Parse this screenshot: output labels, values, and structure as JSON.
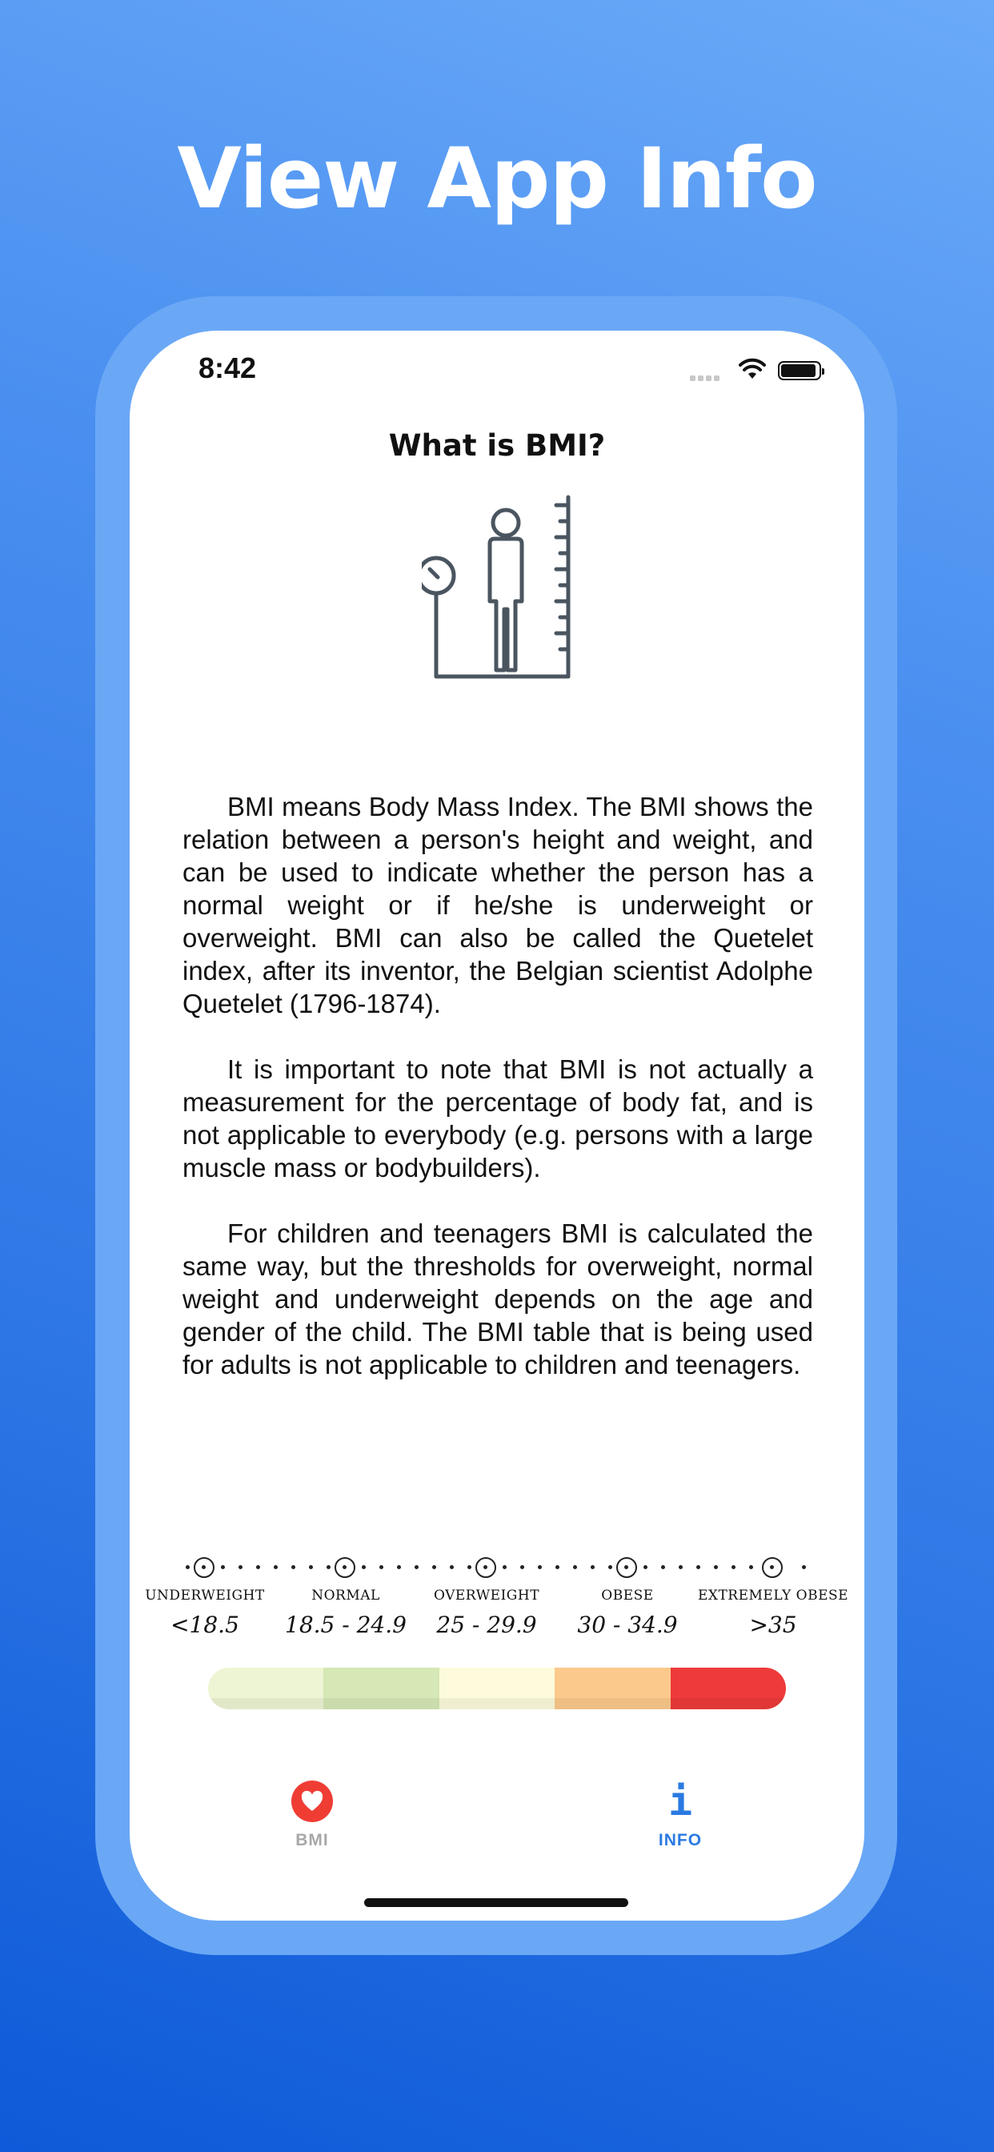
{
  "headline": "View App Info",
  "status_bar": {
    "time": "8:42"
  },
  "page": {
    "title": "What is BMI?"
  },
  "info": {
    "paragraphs": [
      "BMI means Body Mass Index. The BMI shows the relation between a person's height and weight, and can be used to indicate whether the person has a normal weight or if he/she is underweight or overweight. BMI can also be called the Quetelet index, after its inventor, the Belgian scientist Adolphe Quetelet (1796-1874).",
      "It is important to note that BMI is not actually a measurement for the percentage of body fat, and is not applicable to everybody (e.g. persons with a large muscle mass or bodybuilders).",
      "For children and teenagers BMI is calculated the same way, but the thresholds for overweight, normal weight and underweight depends on the age and gender of the child. The BMI table that is being used for adults is not applicable to children and teenagers."
    ]
  },
  "scale": {
    "categories": [
      {
        "label": "UNDERWEIGHT",
        "range": "<18.5"
      },
      {
        "label": "NORMAL",
        "range": "18.5 - 24.9"
      },
      {
        "label": "OVERWEIGHT",
        "range": "25 - 29.9"
      },
      {
        "label": "OBESE",
        "range": "30 - 34.9"
      },
      {
        "label": "EXTREMELY OBESE",
        "range": ">35"
      }
    ],
    "bar_colors": [
      "#eef5d4",
      "#d5e8b5",
      "#fdfbdc",
      "#fbc98b",
      "#ee3a3a"
    ]
  },
  "tabs": {
    "bmi_label": "BMI",
    "info_label": "INFO",
    "active_color": "#2a7ae2",
    "inactive_color": "#a8a8a8"
  },
  "icons": {
    "heart": "heart-icon",
    "info": "info-icon",
    "bmi_illustration": "person-scale-height-icon"
  }
}
